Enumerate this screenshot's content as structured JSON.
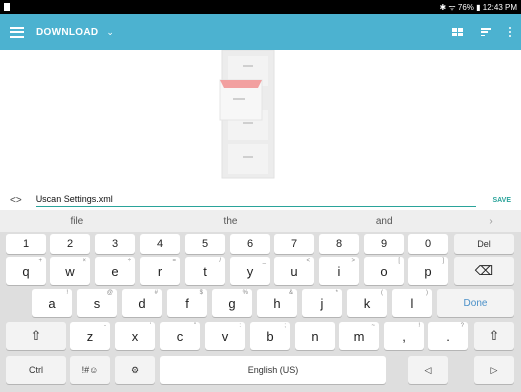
{
  "status": {
    "text": "✱ ᯤ 76% ▮ 12:43 PM"
  },
  "appbar": {
    "title": "DOWNLOAD",
    "caret": "⌄"
  },
  "filebar": {
    "code_icon": "<>",
    "filename": "Uscan Settings.xml",
    "save_label": "SAVE"
  },
  "suggestions": [
    "file",
    "the",
    "and",
    "›"
  ],
  "keyboard": {
    "numbers": [
      "1",
      "2",
      "3",
      "4",
      "5",
      "6",
      "7",
      "8",
      "9",
      "0"
    ],
    "del_label": "Del",
    "row1": [
      "q",
      "w",
      "e",
      "r",
      "t",
      "y",
      "u",
      "i",
      "o",
      "p"
    ],
    "row1_sub": [
      "+",
      "×",
      "÷",
      "=",
      "/",
      "_",
      "<",
      ">",
      "[",
      "]"
    ],
    "row2": [
      "a",
      "s",
      "d",
      "f",
      "g",
      "h",
      "j",
      "k",
      "l"
    ],
    "row2_sub": [
      "!",
      "@",
      "#",
      "$",
      "%",
      "&",
      "*",
      "(",
      ")"
    ],
    "done_label": "Done",
    "row3": [
      "z",
      "x",
      "c",
      "v",
      "b",
      "n",
      "m",
      ",",
      "."
    ],
    "row3_sub": [
      "-",
      "'",
      "\"",
      ":",
      ";",
      "",
      "~",
      "!",
      "?"
    ],
    "ctrl_label": "Ctrl",
    "sym_label": "!#☺",
    "space_label": "English (US)",
    "shift_glyph": "⇧",
    "backspace_glyph": "⌫",
    "settings_glyph": "⚙",
    "left_glyph": "◁",
    "right_glyph": "▷"
  }
}
